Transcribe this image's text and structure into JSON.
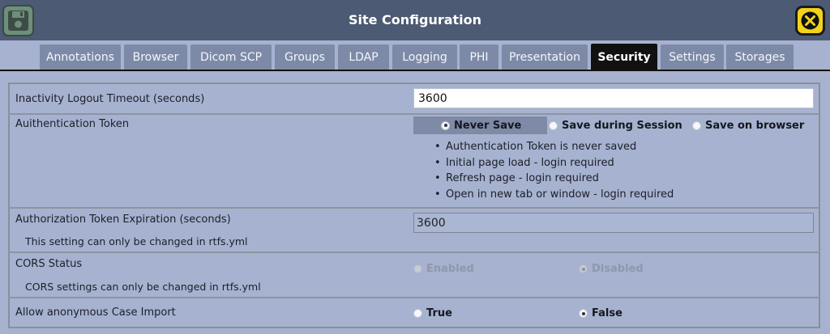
{
  "header": {
    "title": "Site Configuration",
    "save_icon": "floppy-disk-icon",
    "close_icon": "close-x-icon"
  },
  "tabs": [
    {
      "label": "Annotations",
      "active": false
    },
    {
      "label": "Browser",
      "active": false
    },
    {
      "label": "Dicom SCP",
      "active": false
    },
    {
      "label": "Groups",
      "active": false
    },
    {
      "label": "LDAP",
      "active": false
    },
    {
      "label": "Logging",
      "active": false
    },
    {
      "label": "PHI",
      "active": false
    },
    {
      "label": "Presentation",
      "active": false
    },
    {
      "label": "Security",
      "active": true
    },
    {
      "label": "Settings",
      "active": false
    },
    {
      "label": "Storages",
      "active": false
    }
  ],
  "security": {
    "inactivity": {
      "label": "Inactivity Logout Timeout (seconds)",
      "value": "3600"
    },
    "auth_token": {
      "label": "Auithentication Token",
      "options": [
        "Never Save",
        "Save during Session",
        "Save on browser"
      ],
      "selected": "Never Save",
      "notes": [
        "Authentication Token is never saved",
        "Initial page load - login required",
        "Refresh page - login required",
        "Open in new tab or window - login required"
      ]
    },
    "authorization": {
      "label": "Authorization Token Expiration (seconds)",
      "value": "3600",
      "note": "This setting can only be changed in rtfs.yml"
    },
    "cors": {
      "label": "CORS Status",
      "options": [
        "Enabled",
        "Disabled"
      ],
      "selected": "Disabled",
      "note": "CORS settings can only be changed in rtfs.yml"
    },
    "anonymous_import": {
      "label": "Allow anonymous Case Import",
      "options": [
        "True",
        "False"
      ],
      "selected": "False"
    }
  },
  "colors": {
    "header_bg": "#4d5a73",
    "body_bg": "#a6b2cf",
    "tab_bg": "#7d8aa7",
    "tab_active_bg": "#111111",
    "close_yellow": "#f2d31a",
    "save_green": "#6d8f7b"
  }
}
